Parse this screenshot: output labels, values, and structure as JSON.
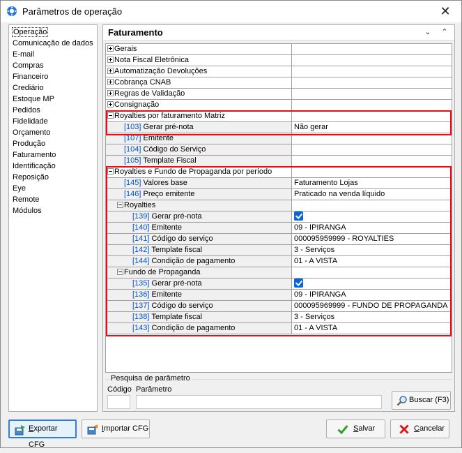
{
  "window": {
    "title": "Parâmetros de operação",
    "close_glyph": "✕"
  },
  "left_menu": [
    "Operação",
    "Comunicação de dados",
    "E-mail",
    "Compras",
    "Financeiro",
    "Crediário",
    "Estoque MP",
    "Pedidos",
    "Fidelidade",
    "Orçamento",
    "Produção",
    "Faturamento",
    "Identificação",
    "Reposição",
    "Eye",
    "Remote",
    "Módulos"
  ],
  "left_menu_selected": "Operação",
  "panel": {
    "title": "Faturamento",
    "collapse_glyph": "⌄",
    "expand_glyph": "⌃"
  },
  "rows": [
    {
      "type": "group",
      "exp": "plus",
      "label": "Gerais",
      "value": ""
    },
    {
      "type": "group",
      "exp": "plus",
      "label": "Nota Fiscal Eletrônica",
      "value": ""
    },
    {
      "type": "group",
      "exp": "plus",
      "label": "Automatização Devoluções",
      "value": ""
    },
    {
      "type": "group",
      "exp": "plus",
      "label": "Cobrança CNAB",
      "value": ""
    },
    {
      "type": "group",
      "exp": "plus",
      "label": "Regras de Validação",
      "value": ""
    },
    {
      "type": "group",
      "exp": "plus",
      "label": "Consignação",
      "value": ""
    },
    {
      "type": "group",
      "exp": "minus",
      "label": "Royalties por faturamento Matriz",
      "value": ""
    },
    {
      "type": "item",
      "indent": 1,
      "code": "[103]",
      "label": "Gerar pré-nota",
      "value": "Não gerar"
    },
    {
      "type": "item",
      "indent": 1,
      "code": "[107]",
      "label": "Emitente",
      "value": ""
    },
    {
      "type": "item",
      "indent": 1,
      "code": "[104]",
      "label": "Código do Serviço",
      "value": ""
    },
    {
      "type": "item",
      "indent": 1,
      "code": "[105]",
      "label": "Template Fiscal",
      "value": ""
    },
    {
      "type": "group",
      "exp": "minus",
      "label": "Royalties e Fundo de Propaganda por período",
      "value": ""
    },
    {
      "type": "item",
      "indent": 1,
      "code": "[145]",
      "label": "Valores base",
      "value": "Faturamento Lojas"
    },
    {
      "type": "item",
      "indent": 1,
      "code": "[146]",
      "label": "Preço emitente",
      "value": "Praticado na venda líquido"
    },
    {
      "type": "subgroup",
      "exp": "minus",
      "label": "Royalties",
      "value": ""
    },
    {
      "type": "item",
      "indent": 2,
      "code": "[139]",
      "label": "Gerar pré-nota",
      "value": "",
      "checkbox": true
    },
    {
      "type": "item",
      "indent": 2,
      "code": "[140]",
      "label": "Emitente",
      "value": "09 - IPIRANGA"
    },
    {
      "type": "item",
      "indent": 2,
      "code": "[141]",
      "label": "Código do serviço",
      "value": "000095959999 - ROYALTIES"
    },
    {
      "type": "item",
      "indent": 2,
      "code": "[142]",
      "label": "Template fiscal",
      "value": "3 - Serviços"
    },
    {
      "type": "item",
      "indent": 2,
      "code": "[144]",
      "label": "Condição de pagamento",
      "value": "01 - A VISTA"
    },
    {
      "type": "subgroup",
      "exp": "minus",
      "label": "Fundo de Propaganda",
      "value": ""
    },
    {
      "type": "item",
      "indent": 2,
      "code": "[135]",
      "label": "Gerar pré-nota",
      "value": "",
      "checkbox": true
    },
    {
      "type": "item",
      "indent": 2,
      "code": "[136]",
      "label": "Emitente",
      "value": "09 - IPIRANGA"
    },
    {
      "type": "item",
      "indent": 2,
      "code": "[137]",
      "label": "Código do serviço",
      "value": "000095969999 - FUNDO DE PROPAGANDA"
    },
    {
      "type": "item",
      "indent": 2,
      "code": "[138]",
      "label": "Template fiscal",
      "value": "3 - Serviços"
    },
    {
      "type": "item",
      "indent": 2,
      "code": "[143]",
      "label": "Condição de pagamento",
      "value": "01 - A VISTA"
    }
  ],
  "search": {
    "legend": "Pesquisa de parâmetro",
    "codigo_label": "Código",
    "parametro_label": "Parâmetro",
    "codigo_value": "",
    "parametro_value": "",
    "button_label": "Buscar (F3)"
  },
  "buttons": {
    "exportar_first": "E",
    "exportar_rest": "xportar CFG",
    "importar_first": "I",
    "importar_rest": "mportar CFG",
    "salvar_first": "S",
    "salvar_rest": "alvar",
    "cancelar_first": "C",
    "cancelar_rest": "ancelar"
  },
  "colors": {
    "highlight_border": "#e2101b",
    "code_text": "#0055cc",
    "checkbox": "#0a64d6"
  }
}
